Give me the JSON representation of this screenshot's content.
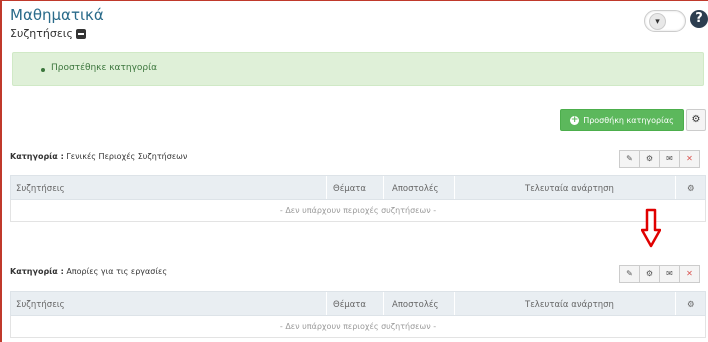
{
  "header": {
    "course_title": "Μαθηματικά",
    "subtitle": "Συζητήσεις",
    "toggle_icon": "graduation-cap-icon",
    "help_label": "?"
  },
  "alert": {
    "message": "Προστέθηκε κατηγορία",
    "color": "#dff0d8"
  },
  "toolbar": {
    "add_category_label": "Προσθήκη κατηγορίας",
    "accent": "#5cb85c"
  },
  "categories": [
    {
      "prefix": "Κατηγορία :",
      "name": "Γενικές Περιοχές Συζητήσεων",
      "columns": [
        "Συζητήσεις",
        "Θέματα",
        "Αποστολές",
        "Τελευταία ανάρτηση"
      ],
      "empty_message": "- Δεν υπάρχουν περιοχές συζητήσεων -"
    },
    {
      "prefix": "Κατηγορία :",
      "name": "Απορίες για τις εργασίες",
      "columns": [
        "Συζητήσεις",
        "Θέματα",
        "Αποστολές",
        "Τελευταία ανάρτηση"
      ],
      "empty_message": "- Δεν υπάρχουν περιοχές συζητήσεων -"
    }
  ],
  "action_icons": [
    "edit-icon",
    "settings-icon",
    "envelope-icon",
    "delete-icon"
  ],
  "annotation_arrow_color": "#e00000"
}
